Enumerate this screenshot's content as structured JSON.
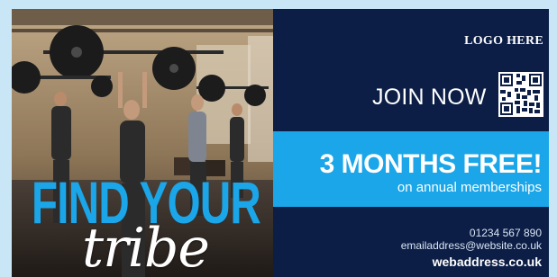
{
  "headline": {
    "line1": "FIND YOUR",
    "line2": "tribe"
  },
  "brand": {
    "logo_text": "LOGO HERE"
  },
  "cta": {
    "join_label": "JOIN NOW"
  },
  "offer": {
    "title": "3 MONTHS FREE!",
    "subtitle": "on annual memberships"
  },
  "contact": {
    "phone": "01234 567 890",
    "email": "emailaddress@website.co.uk",
    "web": "webaddress.co.uk"
  },
  "icons": {
    "qr": "qr-code-icon"
  },
  "colors": {
    "background": "#c9e6f6",
    "navy": "#0c1e46",
    "accent": "#1aa6e8",
    "text": "#ffffff"
  }
}
